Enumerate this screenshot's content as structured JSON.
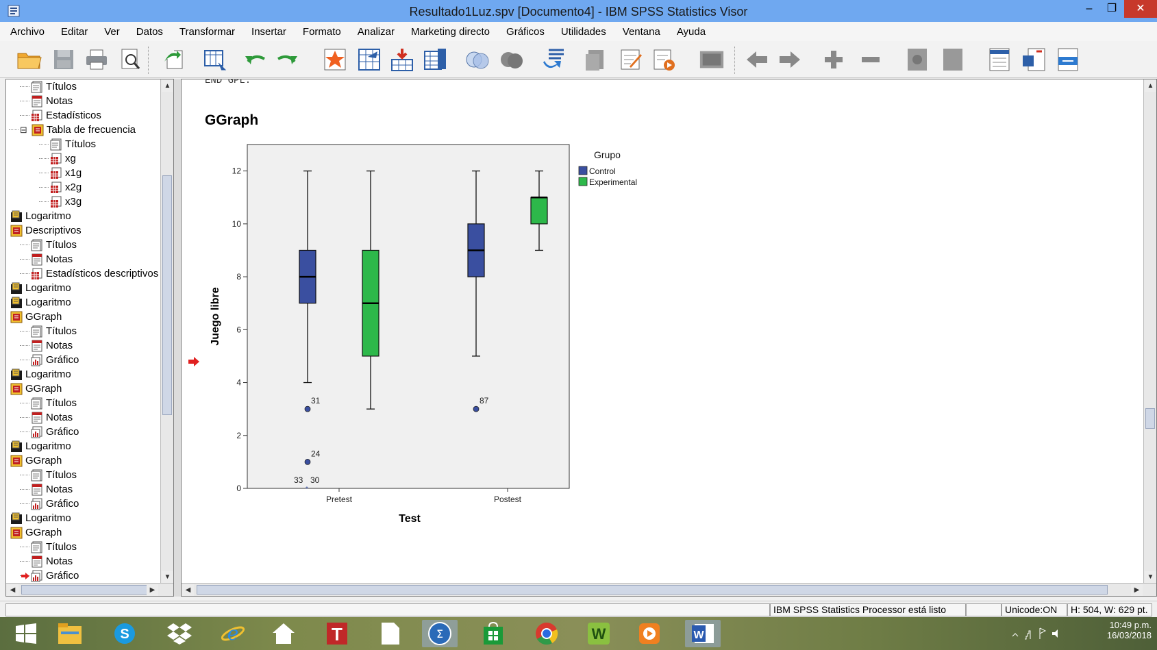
{
  "window": {
    "title": "Resultado1Luz.spv [Documento4] - IBM SPSS Statistics Visor",
    "minimize": "–",
    "maximize": "❐",
    "close": "✕"
  },
  "menu": [
    "Archivo",
    "Editar",
    "Ver",
    "Datos",
    "Transformar",
    "Insertar",
    "Formato",
    "Analizar",
    "Marketing directo",
    "Gráficos",
    "Utilidades",
    "Ventana",
    "Ayuda"
  ],
  "outline": {
    "items": [
      {
        "label": "Títulos",
        "icon": "titles-icon",
        "level": 2
      },
      {
        "label": "Notas",
        "icon": "notes-icon",
        "level": 2
      },
      {
        "label": "Estadísticos",
        "icon": "table-icon",
        "level": 2
      },
      {
        "label": "Tabla de frecuencia",
        "icon": "folder-icon",
        "level": 1,
        "expander": "⊟"
      },
      {
        "label": "Títulos",
        "icon": "titles-icon",
        "level": 3
      },
      {
        "label": "xg",
        "icon": "table-icon",
        "level": 3
      },
      {
        "label": "x1g",
        "icon": "table-icon",
        "level": 3
      },
      {
        "label": "x2g",
        "icon": "table-icon",
        "level": 3
      },
      {
        "label": "x3g",
        "icon": "table-icon",
        "level": 3
      },
      {
        "label": "Logaritmo",
        "icon": "log-icon",
        "level": 0
      },
      {
        "label": "Descriptivos",
        "icon": "folder-icon",
        "level": 0
      },
      {
        "label": "Títulos",
        "icon": "titles-icon",
        "level": 2
      },
      {
        "label": "Notas",
        "icon": "notes-icon",
        "level": 2
      },
      {
        "label": "Estadísticos descriptivos",
        "icon": "table-icon",
        "level": 2
      },
      {
        "label": "Logaritmo",
        "icon": "log-icon",
        "level": 0
      },
      {
        "label": "Logaritmo",
        "icon": "log-icon",
        "level": 0
      },
      {
        "label": "GGraph",
        "icon": "folder-icon",
        "level": 0
      },
      {
        "label": "Títulos",
        "icon": "titles-icon",
        "level": 2
      },
      {
        "label": "Notas",
        "icon": "notes-icon",
        "level": 2
      },
      {
        "label": "Gráfico",
        "icon": "chart-icon",
        "level": 2
      },
      {
        "label": "Logaritmo",
        "icon": "log-icon",
        "level": 0
      },
      {
        "label": "GGraph",
        "icon": "folder-icon",
        "level": 0
      },
      {
        "label": "Títulos",
        "icon": "titles-icon",
        "level": 2
      },
      {
        "label": "Notas",
        "icon": "notes-icon",
        "level": 2
      },
      {
        "label": "Gráfico",
        "icon": "chart-icon",
        "level": 2
      },
      {
        "label": "Logaritmo",
        "icon": "log-icon",
        "level": 0
      },
      {
        "label": "GGraph",
        "icon": "folder-icon",
        "level": 0
      },
      {
        "label": "Títulos",
        "icon": "titles-icon",
        "level": 2
      },
      {
        "label": "Notas",
        "icon": "notes-icon",
        "level": 2
      },
      {
        "label": "Gráfico",
        "icon": "chart-icon",
        "level": 2
      },
      {
        "label": "Logaritmo",
        "icon": "log-icon",
        "level": 0
      },
      {
        "label": "GGraph",
        "icon": "folder-icon",
        "level": 0
      },
      {
        "label": "Títulos",
        "icon": "titles-icon",
        "level": 2
      },
      {
        "label": "Notas",
        "icon": "notes-icon",
        "level": 2
      },
      {
        "label": "Gráfico",
        "icon": "chart-icon",
        "level": 2,
        "current": true
      }
    ]
  },
  "content": {
    "cropped_text": "END GPL.",
    "heading": "GGraph"
  },
  "chart_data": {
    "type": "boxplot",
    "title": "",
    "xlabel": "Test",
    "ylabel": "Juego libre",
    "ylim": [
      0,
      13
    ],
    "yticks": [
      0,
      2,
      4,
      6,
      8,
      10,
      12
    ],
    "categories": [
      "Pretest",
      "Postest"
    ],
    "legend_title": "Grupo",
    "legend_position": "right",
    "series": [
      {
        "name": "Control",
        "color": "#3a4fa0",
        "boxes": [
          {
            "category": "Pretest",
            "min": 4,
            "q1": 7,
            "median": 8,
            "q3": 9,
            "max": 12,
            "outliers": [
              {
                "value": 3,
                "label": "31"
              },
              {
                "value": 1,
                "label": "24"
              },
              {
                "value": 0,
                "label": "33",
                "label2": "30"
              }
            ]
          },
          {
            "category": "Postest",
            "min": 5,
            "q1": 8,
            "median": 9,
            "q3": 10,
            "max": 12,
            "outliers": [
              {
                "value": 3,
                "label": "87"
              }
            ]
          }
        ]
      },
      {
        "name": "Experimental",
        "color": "#2db84a",
        "boxes": [
          {
            "category": "Pretest",
            "min": 3,
            "q1": 5,
            "median": 7,
            "q3": 9,
            "max": 12,
            "outliers": []
          },
          {
            "category": "Postest",
            "min": 9,
            "q1": 10,
            "median": 11,
            "q3": 11,
            "max": 12,
            "outliers": []
          }
        ]
      }
    ],
    "plot_background": "#f0f0f0"
  },
  "status": {
    "processor": "IBM SPSS Statistics Processor está listo",
    "unicode": "Unicode:ON",
    "size": "H: 504, W: 629 pt."
  },
  "taskbar": {
    "time": "10:49 p.m.",
    "date": "16/03/2018"
  },
  "colors": {
    "titlebar": "#6fa8f0",
    "control": "#3a4fa0",
    "experimental": "#2db84a"
  }
}
